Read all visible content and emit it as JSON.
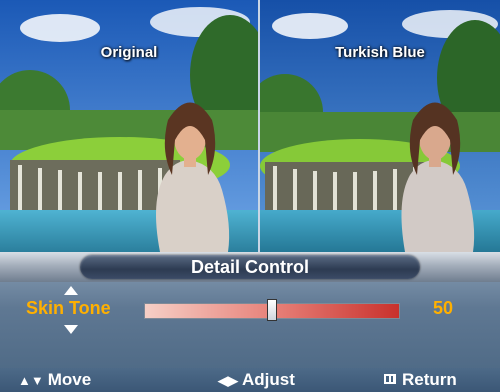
{
  "preview": {
    "left_label": "Original",
    "right_label": "Turkish Blue"
  },
  "osd": {
    "title": "Detail Control",
    "setting": {
      "label": "Skin Tone",
      "value": "50",
      "level_fraction": 0.5
    },
    "hints": {
      "move": "Move",
      "adjust": "Adjust",
      "return": "Return"
    },
    "colors": {
      "accent": "#ffb000",
      "panel": "#5f7893"
    }
  }
}
